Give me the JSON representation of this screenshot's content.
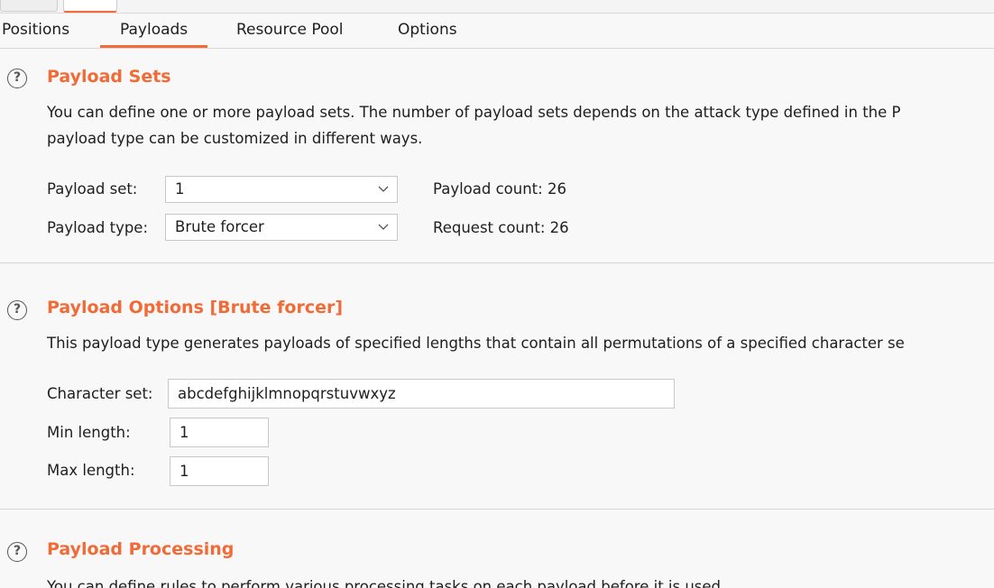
{
  "top_tabs": [
    "",
    "",
    ""
  ],
  "tabs": [
    "Positions",
    "Payloads",
    "Resource Pool",
    "Options"
  ],
  "active_tab": "Payloads",
  "accent_color": "#f26a36",
  "payload_sets": {
    "title": "Payload Sets",
    "desc_line1": "You can define one or more payload sets. The number of payload sets depends on the attack type defined in the P",
    "desc_line2": "payload type can be customized in different ways.",
    "set_label": "Payload set:",
    "set_value": "1",
    "type_label": "Payload type:",
    "type_value": "Brute forcer",
    "payload_count": "Payload count: 26",
    "request_count": "Request count: 26"
  },
  "payload_options": {
    "title": "Payload Options [Brute forcer]",
    "desc": "This payload type generates payloads of specified lengths that contain all permutations of a specified character se",
    "charset_label": "Character set:",
    "charset_value": "abcdefghijklmnopqrstuvwxyz",
    "min_label": "Min length:",
    "min_value": "1",
    "max_label": "Max length:",
    "max_value": "1"
  },
  "payload_processing": {
    "title": "Payload Processing",
    "desc": "You can define rules to perform various processing tasks on each payload before it is used."
  },
  "icons": {
    "help": "help-circle-icon",
    "dropdown": "chevron-down-icon"
  }
}
